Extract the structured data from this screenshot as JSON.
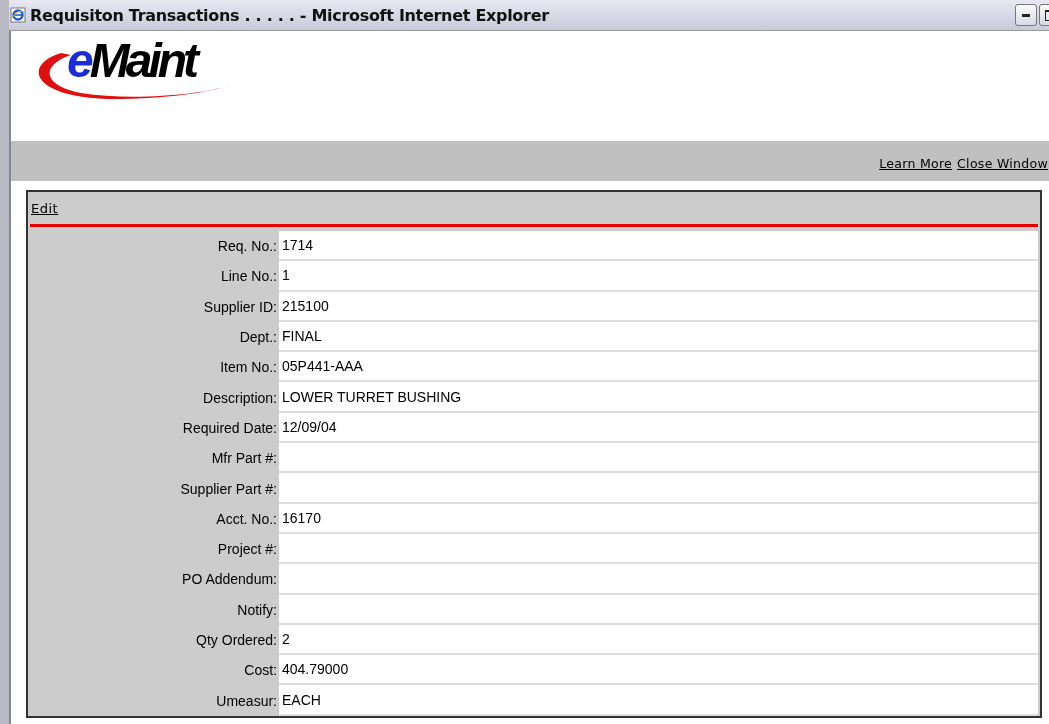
{
  "window": {
    "title": "Requisiton Transactions . . . . . - Microsoft Internet Explorer"
  },
  "logo": {
    "accent": "e",
    "text": "Maint"
  },
  "header_links": [
    "Learn More",
    "Close Window"
  ],
  "toolbar": {
    "link": "Edit"
  },
  "fields": [
    {
      "label": "Req. No.:",
      "value": "1714"
    },
    {
      "label": "Line No.:",
      "value": "1"
    },
    {
      "label": "Supplier ID:",
      "value": "215100"
    },
    {
      "label": "Dept.:",
      "value": "FINAL"
    },
    {
      "label": "Item No.:",
      "value": "05P441-AAA"
    },
    {
      "label": "Description:",
      "value": "LOWER TURRET BUSHING"
    },
    {
      "label": "Required Date:",
      "value": "12/09/04"
    },
    {
      "label": "Mfr Part #:"
    },
    {
      "label": "Supplier Part #:"
    },
    {
      "label": "Acct. No.:",
      "value": "16170"
    },
    {
      "label": "Project #:"
    },
    {
      "label": "PO Addendum:"
    },
    {
      "label": "Notify:"
    },
    {
      "label": "Qty Ordered:",
      "value": "2"
    },
    {
      "label": "Cost:",
      "value": "404.79000"
    },
    {
      "label": "Umeasur:",
      "value": "EACH"
    }
  ]
}
